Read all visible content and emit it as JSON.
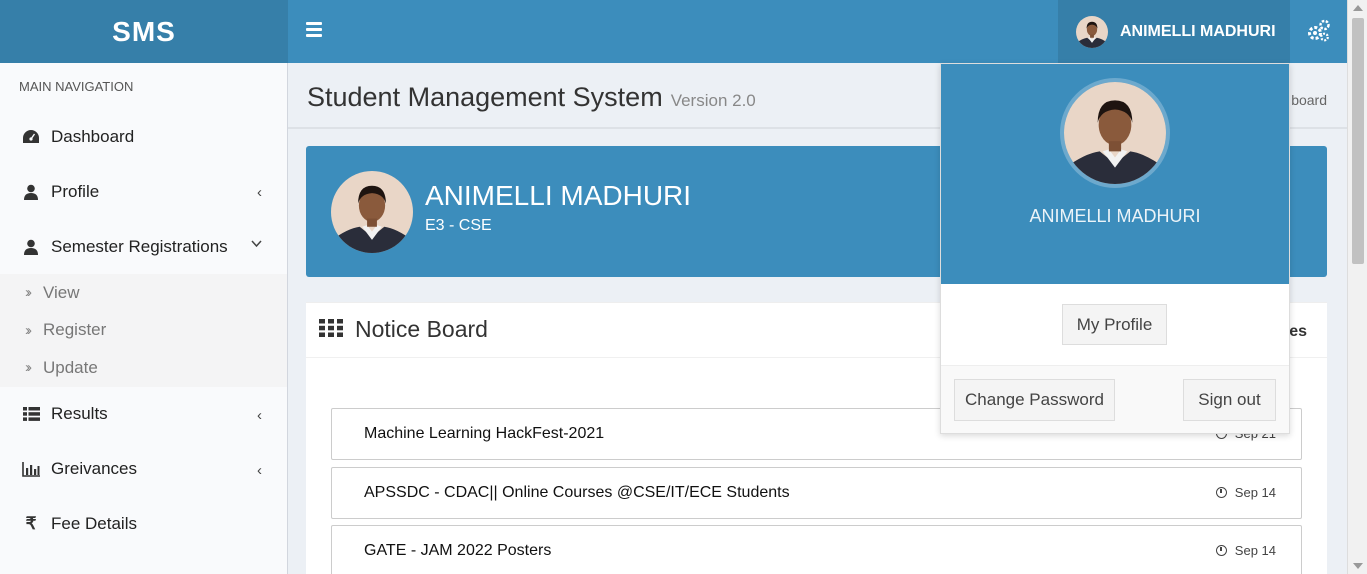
{
  "app": {
    "logo": "SMS"
  },
  "header": {
    "user_name": "ANIMELLI MADHURI"
  },
  "sidebar": {
    "header": "MAIN NAVIGATION",
    "items": [
      {
        "label": "Dashboard",
        "icon": "dashboard-icon"
      },
      {
        "label": "Profile",
        "icon": "user-icon"
      },
      {
        "label": "Semester Registrations",
        "icon": "user-icon"
      },
      {
        "label": "Results",
        "icon": "list-icon"
      },
      {
        "label": "Greivances",
        "icon": "bar-chart-icon"
      },
      {
        "label": "Fee Details",
        "icon": "rupee-icon"
      }
    ],
    "submenu": [
      {
        "label": "View"
      },
      {
        "label": "Register"
      },
      {
        "label": "Update"
      }
    ]
  },
  "page": {
    "title": "Student Management System",
    "version": "Version 2.0",
    "breadcrumb": "board"
  },
  "profile_card": {
    "name": "ANIMELLI MADHURI",
    "branch": "E3 - CSE"
  },
  "notice_board": {
    "title": "Notice Board",
    "updates_label": "es",
    "notices": [
      {
        "title": "Machine Learning HackFest-2021",
        "date": "Sep 21"
      },
      {
        "title": "APSSDC - CDAC|| Online Courses @CSE/IT/ECE Students",
        "date": "Sep 14"
      },
      {
        "title": "GATE - JAM 2022 Posters",
        "date": "Sep 14"
      }
    ]
  },
  "dropdown": {
    "name": "ANIMELLI MADHURI",
    "my_profile": "My Profile",
    "change_password": "Change Password",
    "sign_out": "Sign out"
  },
  "colors": {
    "primary": "#3c8dbc",
    "primary_dark": "#367fa9",
    "sidebar_bg": "#f9fafc",
    "content_bg": "#ecf0f5"
  }
}
